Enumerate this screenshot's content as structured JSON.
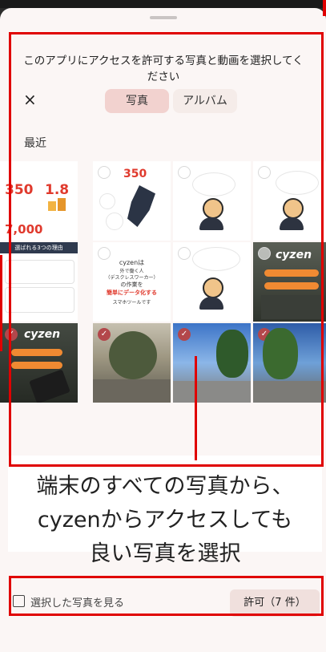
{
  "sheet": {
    "prompt": "このアプリにアクセスを許可する写真と動画を選択してください",
    "close_symbol": "×",
    "tabs": [
      {
        "label": "写真",
        "selected": true
      },
      {
        "label": "アルバム",
        "selected": false
      }
    ],
    "section_title": "最近"
  },
  "thumbnails": {
    "t1": {
      "stat1_value": "350",
      "stat2_value": "1.8",
      "stat3_value": "7,000"
    },
    "t2": {
      "value": "350"
    },
    "t5": {
      "title": "選ばれる3つの理由"
    },
    "t6": {
      "line1": "cyzenは",
      "line2": "外で働く人",
      "line3": "（デスクレスワーカー）",
      "line4": "の作業を",
      "line5": "簡単にデータ化する",
      "line6": "スマホツールです"
    },
    "t8": {
      "logo": "cyzen"
    },
    "t9": {
      "logo": "cyzen"
    }
  },
  "caption": {
    "line1": "端末のすべての写真から、",
    "line2": "cyzenからアクセスしても",
    "line3": "良い写真を選択"
  },
  "footer": {
    "view_selected_label": "選択した写真を見る",
    "allow_label": "許可（7 件）"
  },
  "colors": {
    "accent_check": "#b3474b",
    "tab_selected_bg": "#f2d2cf",
    "annotation_red": "#e00000"
  }
}
